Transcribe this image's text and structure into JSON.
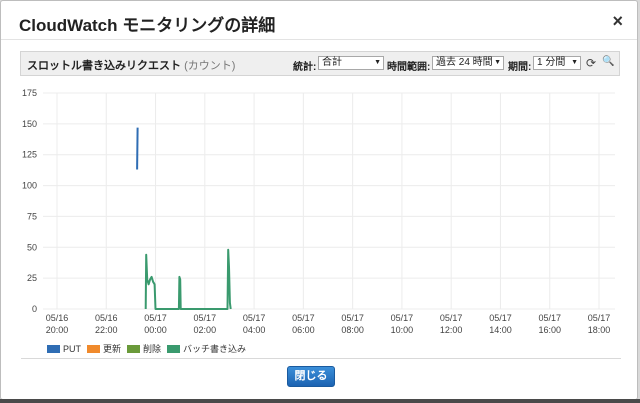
{
  "dialog": {
    "title": "CloudWatch モニタリングの詳細",
    "close_label": "×",
    "close_button_label": "閉じる"
  },
  "toolbar": {
    "metric_name": "スロットル書き込みリクエスト",
    "metric_unit": "(カウント)",
    "statistic_label": "統計:",
    "statistic_value": "合計",
    "time_range_label": "時間範囲:",
    "time_range_value": "過去 24 時間",
    "period_label": "期間:",
    "period_value": "1 分間",
    "dropdown_arrow": "▼",
    "refresh_icon": "refresh-icon",
    "zoom_icon": "zoom-icon",
    "refresh_glyph": "⟳",
    "zoom_glyph": "🔍"
  },
  "chart_data": {
    "type": "line",
    "ylim": [
      0,
      175
    ],
    "y_ticks": [
      0,
      25,
      50,
      75,
      100,
      125,
      150,
      175
    ],
    "x_ticks": [
      {
        "date": "05/16",
        "time": "20:00"
      },
      {
        "date": "05/16",
        "time": "22:00"
      },
      {
        "date": "05/17",
        "time": "00:00"
      },
      {
        "date": "05/17",
        "time": "02:00"
      },
      {
        "date": "05/17",
        "time": "04:00"
      },
      {
        "date": "05/17",
        "time": "06:00"
      },
      {
        "date": "05/17",
        "time": "08:00"
      },
      {
        "date": "05/17",
        "time": "10:00"
      },
      {
        "date": "05/17",
        "time": "12:00"
      },
      {
        "date": "05/17",
        "time": "14:00"
      },
      {
        "date": "05/17",
        "time": "16:00"
      },
      {
        "date": "05/17",
        "time": "18:00"
      }
    ],
    "grid": true,
    "legend": "bottom-left",
    "series": [
      {
        "name": "PUT",
        "color": "#2f6db4",
        "points": [
          [
            23.25,
            113
          ],
          [
            23.27,
            147
          ]
        ]
      },
      {
        "name": "更新",
        "color": "#f08a2c",
        "points": []
      },
      {
        "name": "削除",
        "color": "#6a9a3a",
        "points": []
      },
      {
        "name": "バッチ書き込み",
        "color": "#3a9a6e",
        "points": [
          [
            23.6,
            0
          ],
          [
            23.62,
            44
          ],
          [
            23.66,
            24
          ],
          [
            23.72,
            20
          ],
          [
            23.78,
            24
          ],
          [
            23.84,
            26
          ],
          [
            23.9,
            22
          ],
          [
            23.96,
            20
          ],
          [
            24.0,
            0
          ],
          [
            24.95,
            0
          ],
          [
            24.97,
            26
          ],
          [
            25.0,
            24
          ],
          [
            25.02,
            0
          ],
          [
            26.92,
            0
          ],
          [
            26.95,
            48
          ],
          [
            26.98,
            34
          ],
          [
            27.02,
            5
          ],
          [
            27.05,
            0
          ]
        ]
      }
    ]
  }
}
